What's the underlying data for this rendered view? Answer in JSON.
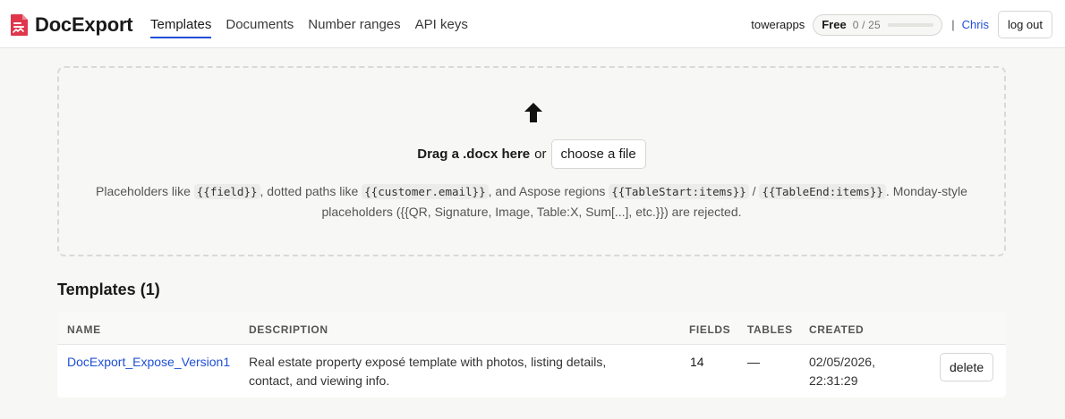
{
  "header": {
    "brand": "DocExport",
    "brand_color": "#e0364b",
    "accent_color": "#1f4fd6",
    "nav": [
      {
        "label": "Templates",
        "active": true
      },
      {
        "label": "Documents",
        "active": false
      },
      {
        "label": "Number ranges",
        "active": false
      },
      {
        "label": "API keys",
        "active": false
      }
    ],
    "tenant": "towerapps",
    "plan": {
      "name": "Free",
      "usage": "0 / 25",
      "used_fraction": 0
    },
    "separator": "|",
    "user": "Chris",
    "logout_label": "log out"
  },
  "upload": {
    "icon": "upload-arrow-icon",
    "drag_text": "Drag a .docx here",
    "or_text": "or",
    "choose_label": "choose a file",
    "hint": {
      "t1": "Placeholders like ",
      "c1": "{{field}}",
      "t2": ", dotted paths like ",
      "c2": "{{customer.email}}",
      "t3": ", and Aspose regions ",
      "c3": "{{TableStart:items}}",
      "t4": " / ",
      "c4": "{{TableEnd:items}}",
      "t5": ". Monday-style placeholders ({{QR, Signature, Image, Table:X, Sum[...], etc.}}) are rejected."
    }
  },
  "templates": {
    "title": "Templates (1)",
    "columns": {
      "name": "NAME",
      "description": "DESCRIPTION",
      "fields": "FIELDS",
      "tables": "TABLES",
      "created": "CREATED"
    },
    "rows": [
      {
        "name": "DocExport_Expose_Version1",
        "description_line1": "Real estate property exposé template with photos, listing details,",
        "description_line2": "contact, and viewing info.",
        "fields": "14",
        "tables": "—",
        "created_line1": "02/05/2026,",
        "created_line2": "22:31:29",
        "delete_label": "delete"
      }
    ]
  }
}
